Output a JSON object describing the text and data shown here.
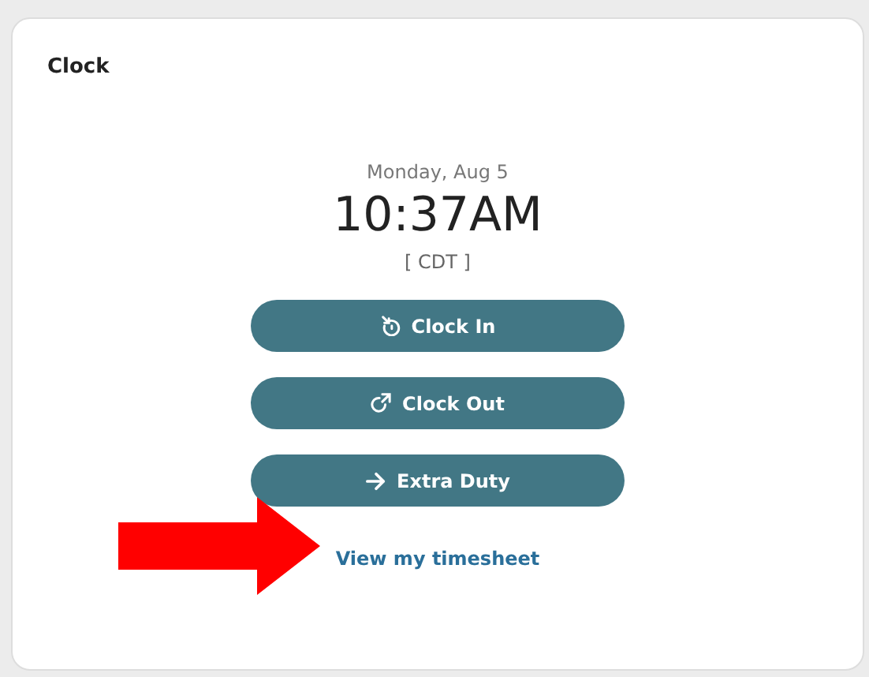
{
  "card": {
    "title": "Clock"
  },
  "date": "Monday, Aug 5",
  "time": "10:37AM",
  "timezone": "[ CDT ]",
  "buttons": [
    {
      "label": "Clock In",
      "kind": "clock-in"
    },
    {
      "label": "Clock Out",
      "kind": "clock-out"
    },
    {
      "label": "Extra Duty",
      "kind": "extra"
    }
  ],
  "link": "View my timesheet",
  "annotation": {
    "kind": "arrow"
  }
}
